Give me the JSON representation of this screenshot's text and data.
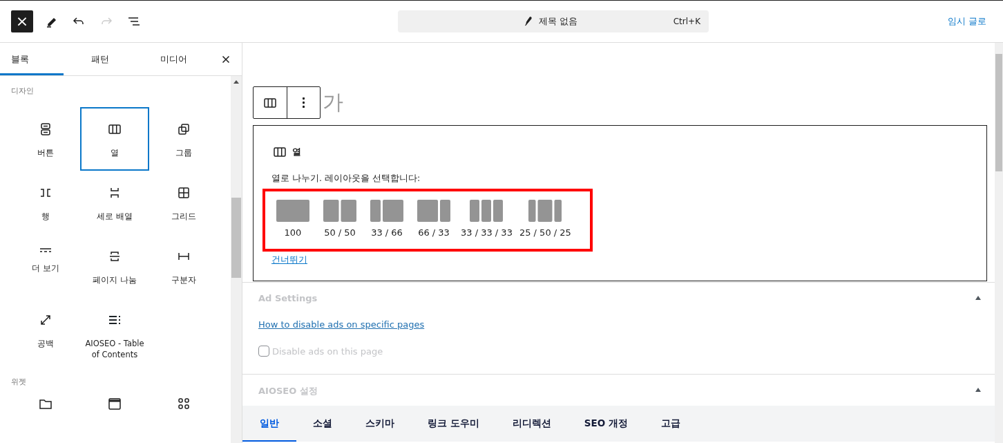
{
  "top_bar": {
    "close_label": "×",
    "document": {
      "title": "제목 없음",
      "shortcut": "Ctrl+K"
    },
    "save_draft": "임시 글로"
  },
  "inserter": {
    "tabs": [
      {
        "label": "블록",
        "selected": true
      },
      {
        "label": "패턴",
        "selected": false
      },
      {
        "label": "미디어",
        "selected": false
      }
    ],
    "categories": [
      {
        "title": "디자인",
        "blocks": [
          {
            "label": "버튼",
            "kind": "buttons",
            "selected": false
          },
          {
            "label": "열",
            "kind": "columns",
            "selected": true
          },
          {
            "label": "그룹",
            "kind": "group",
            "selected": false
          },
          {
            "label": "행",
            "kind": "row",
            "selected": false
          },
          {
            "label": "세로 배열",
            "kind": "stack",
            "selected": false
          },
          {
            "label": "그리드",
            "kind": "grid",
            "selected": false
          },
          {
            "label": "더 보기",
            "kind": "more",
            "selected": false
          },
          {
            "label": "페이지 나눔",
            "kind": "pagebreak",
            "selected": false
          },
          {
            "label": "구분자",
            "kind": "separator",
            "selected": false
          },
          {
            "label": "공백",
            "kind": "spacer",
            "selected": false
          },
          {
            "label": "AIOSEO - Table of Contents",
            "kind": "toc",
            "selected": false
          }
        ]
      },
      {
        "title": "위젯",
        "blocks": [
          {
            "kind": "archive"
          },
          {
            "kind": "calendar"
          },
          {
            "kind": "categories"
          }
        ]
      }
    ]
  },
  "editor": {
    "title_visible": "가",
    "columns_block": {
      "name": "열",
      "instruction": "열로 나누기. 레이아웃을 선택합니다:",
      "highlighted": true,
      "layouts": [
        {
          "label": "100",
          "kind": "full"
        },
        {
          "label": "50 / 50",
          "kind": "halves"
        },
        {
          "label": "33 / 66",
          "kind": "third-twothirds"
        },
        {
          "label": "66 / 33",
          "kind": "twothirds-third"
        },
        {
          "label": "33 / 33 / 33",
          "kind": "thirds"
        },
        {
          "label": "25 / 50 / 25",
          "kind": "quarter-half-quarter"
        }
      ],
      "skip": "건너뛰기"
    }
  },
  "ad_settings": {
    "title": "Ad Settings",
    "expanded": true,
    "link": "How to disable ads on specific pages",
    "checkbox": {
      "label": "Disable ads on this page",
      "checked": false
    }
  },
  "aioseo": {
    "title": "AIOSEO 설정",
    "expanded": true,
    "tabs": [
      {
        "label": "일반",
        "selected": true
      },
      {
        "label": "소셜",
        "selected": false
      },
      {
        "label": "스키마",
        "selected": false
      },
      {
        "label": "링크 도우미",
        "selected": false
      },
      {
        "label": "리디렉션",
        "selected": false
      },
      {
        "label": "SEO 개정",
        "selected": false
      },
      {
        "label": "고급",
        "selected": false
      }
    ]
  }
}
